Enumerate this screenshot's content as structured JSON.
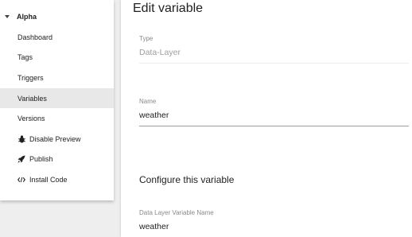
{
  "sidebar": {
    "container_name": "Alpha",
    "items": [
      {
        "label": "Dashboard",
        "icon": "",
        "active": false
      },
      {
        "label": "Tags",
        "icon": "",
        "active": false
      },
      {
        "label": "Triggers",
        "icon": "",
        "active": false
      },
      {
        "label": "Variables",
        "icon": "",
        "active": true
      },
      {
        "label": "Versions",
        "icon": "",
        "active": false
      },
      {
        "label": "Disable Preview",
        "icon": "bug-icon",
        "active": false
      },
      {
        "label": "Publish",
        "icon": "rocket-icon",
        "active": false
      },
      {
        "label": "Install Code",
        "icon": "code-icon",
        "active": false
      }
    ]
  },
  "main": {
    "title": "Edit variable",
    "type_field": {
      "label": "Type",
      "value": "Data-Layer"
    },
    "name_field": {
      "label": "Name",
      "value": "weather"
    },
    "section_title": "Configure this variable",
    "dl_name_field": {
      "label": "Data Layer Variable Name",
      "value": "weather"
    }
  },
  "colors": {
    "active_bg": "#e8e8e8",
    "page_bg": "#eeeeee",
    "text": "#212121",
    "muted": "#8a8a8a"
  }
}
